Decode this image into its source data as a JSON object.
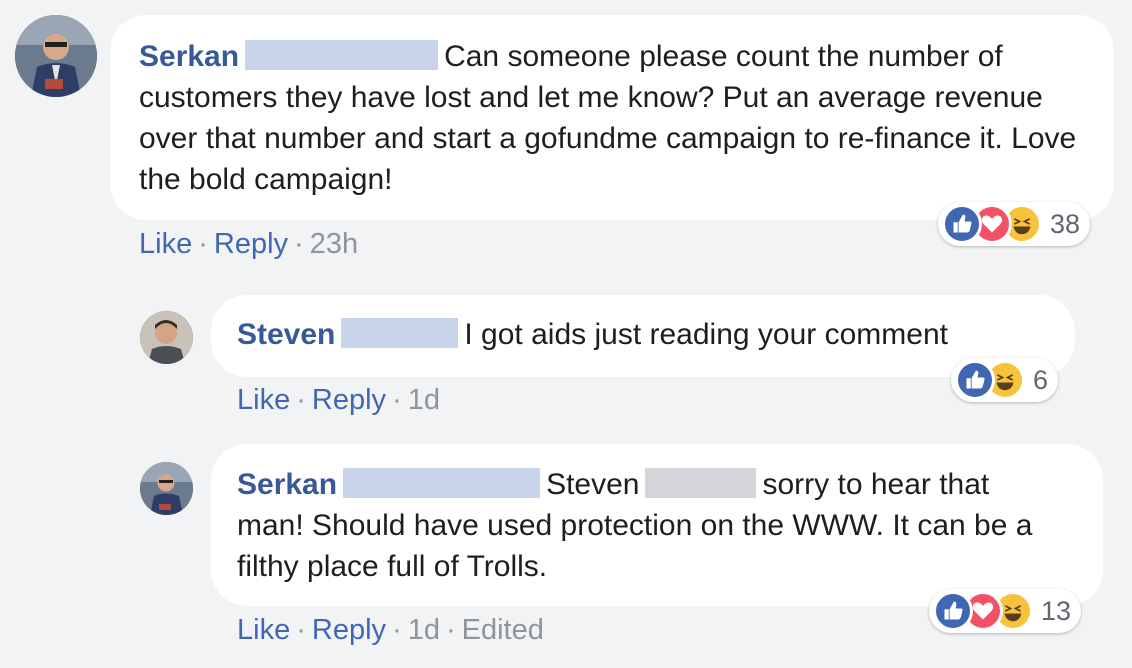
{
  "comments": [
    {
      "author": "Serkan",
      "text": "Can someone please count the number of customers they have lost and let me know? Put an average revenue over that number and start a gofundme campaign to re-finance it. Love the bold campaign!",
      "actions": {
        "like": "Like",
        "reply": "Reply",
        "time": "23h"
      },
      "reactions": {
        "types": [
          "like-icon",
          "love-icon",
          "haha-icon"
        ],
        "count": "38"
      }
    },
    {
      "author": "Steven",
      "text": "I got aids just reading your comment",
      "actions": {
        "like": "Like",
        "reply": "Reply",
        "time": "1d"
      },
      "reactions": {
        "types": [
          "like-icon",
          "haha-icon"
        ],
        "count": "6"
      }
    },
    {
      "author": "Serkan",
      "mention": "Steven",
      "text_part1": "sorry to hear that",
      "text_part2": "man! Should have used protection on the WWW. It can be a filthy place full of Trolls.",
      "actions": {
        "like": "Like",
        "reply": "Reply",
        "time": "1d",
        "edited": "Edited"
      },
      "reactions": {
        "types": [
          "like-icon",
          "love-icon",
          "haha-icon"
        ],
        "count": "13"
      }
    }
  ],
  "separator": "·",
  "colors": {
    "name": "#385898",
    "link": "#4267b2",
    "like": "#4267b2",
    "love": "#f25268",
    "haha": "#f7c23c"
  }
}
